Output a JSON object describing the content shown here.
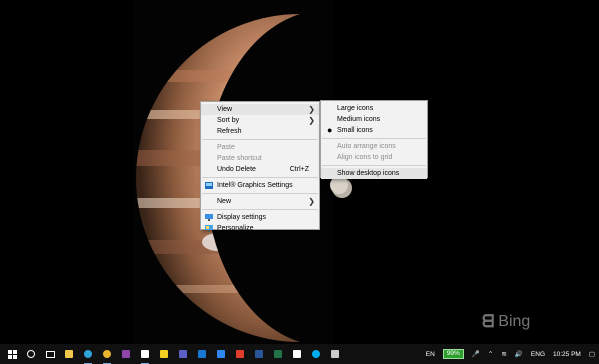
{
  "desktop": {
    "watermark": "Bing",
    "context_menu": {
      "items": [
        {
          "label": "View",
          "submenu": true,
          "highlighted": true
        },
        {
          "label": "Sort by",
          "submenu": true
        },
        {
          "label": "Refresh"
        },
        {
          "label": "Paste",
          "disabled": true
        },
        {
          "label": "Paste shortcut",
          "disabled": true
        },
        {
          "label": "Undo Delete",
          "shortcut": "Ctrl+Z"
        },
        {
          "label": "Intel® Graphics Settings",
          "icon": "intel-graphics-icon"
        },
        {
          "label": "New",
          "submenu": true
        },
        {
          "label": "Display settings",
          "icon": "display-icon"
        },
        {
          "label": "Personalize",
          "icon": "personalize-icon"
        }
      ]
    },
    "view_submenu": {
      "items": [
        {
          "label": "Large icons"
        },
        {
          "label": "Medium icons"
        },
        {
          "label": "Small icons",
          "checked": true
        },
        {
          "label": "Auto arrange icons",
          "disabled": true
        },
        {
          "label": "Align icons to grid",
          "disabled": true
        },
        {
          "label": "Show desktop icons",
          "highlighted": true
        }
      ]
    }
  },
  "taskbar": {
    "apps": [
      {
        "icon": "start-icon",
        "color": "#ffffff"
      },
      {
        "icon": "search-icon",
        "color": "#ffffff"
      },
      {
        "icon": "task-view-icon",
        "color": "#ffffff"
      },
      {
        "icon": "file-explorer-icon",
        "color": "#f2c94c"
      },
      {
        "icon": "edge-icon",
        "color": "#2fa4d8",
        "active": true
      },
      {
        "icon": "chrome-icon",
        "color": "#e8b530",
        "active": true
      },
      {
        "icon": "onenote-icon",
        "color": "#8e44ad"
      },
      {
        "icon": "settings-icon",
        "color": "#ffffff",
        "active": true
      },
      {
        "icon": "sticky-notes-icon",
        "color": "#f5d020"
      },
      {
        "icon": "teams-icon",
        "color": "#5b5fc7"
      },
      {
        "icon": "outlook-icon",
        "color": "#1976d2"
      },
      {
        "icon": "store-icon",
        "color": "#2d89ef"
      },
      {
        "icon": "office-icon",
        "color": "#e03e2d"
      },
      {
        "icon": "word-icon",
        "color": "#2b579a"
      },
      {
        "icon": "excel-icon",
        "color": "#217346"
      },
      {
        "icon": "messaging-icon",
        "color": "#ffffff"
      },
      {
        "icon": "skype-icon",
        "color": "#00aff0"
      },
      {
        "icon": "photos-icon",
        "color": "#cccccc"
      }
    ],
    "tray": {
      "input_language": "EN",
      "battery_percent": "99%",
      "language": "ENG",
      "time": "10:25 PM"
    }
  }
}
